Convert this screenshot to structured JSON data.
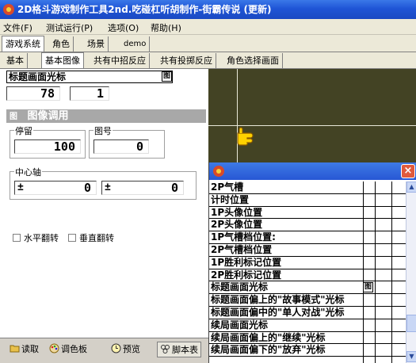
{
  "window": {
    "title": "2D格斗游戏制作工具2nd.吃碰杠听胡制作-街霸传说 (更新)"
  },
  "menu": {
    "items": [
      "文件(F)",
      "测试运行(P)",
      "选项(O)",
      "帮助(H)"
    ]
  },
  "tabs_main": [
    "游戏系统",
    "角色",
    "场景",
    "demo"
  ],
  "tabs_sub": [
    "基本",
    "基本图像",
    "共有中招反应",
    "共有投掷反应",
    "角色选择画面"
  ],
  "editor": {
    "header_title": "标题画面光标",
    "value_left": "78",
    "value_right": "1",
    "section_title": "图像调用",
    "section_icon": "图",
    "stay_label": "停留",
    "stay_value": "100",
    "image_no_label": "图号",
    "image_no_value": "0",
    "center_axis_label": "中心轴",
    "center_x_sign": "±",
    "center_x_value": "0",
    "center_y_sign": "±",
    "center_y_value": "0",
    "flip_h_label": "水平翻转",
    "flip_v_label": "垂直翻转"
  },
  "bottom_buttons": [
    "读取",
    "调色板",
    "预览",
    "脚本表"
  ],
  "popup_list": {
    "items": [
      "2P气槽",
      "计时位置",
      "1P头像位置",
      "2P头像位置",
      "1P气槽档位置:",
      "2P气槽档位置",
      "1P胜利标记位置",
      "2P胜利标记位置",
      "标题画面光标",
      "标题画面偏上的\"故事模式\"光标",
      "标题画面偏中的\"单人对战\"光标",
      "续局画面光标",
      "续局画面偏上的\"继续\"光标",
      "续局画面偏下的\"放弃\"光标"
    ],
    "row_marker": "图"
  },
  "colors": {
    "title_bar": "#1f55d6",
    "canvas_bg": "#434324",
    "cursor_yellow": "#ffd200",
    "close_button": "#e05a3c"
  }
}
